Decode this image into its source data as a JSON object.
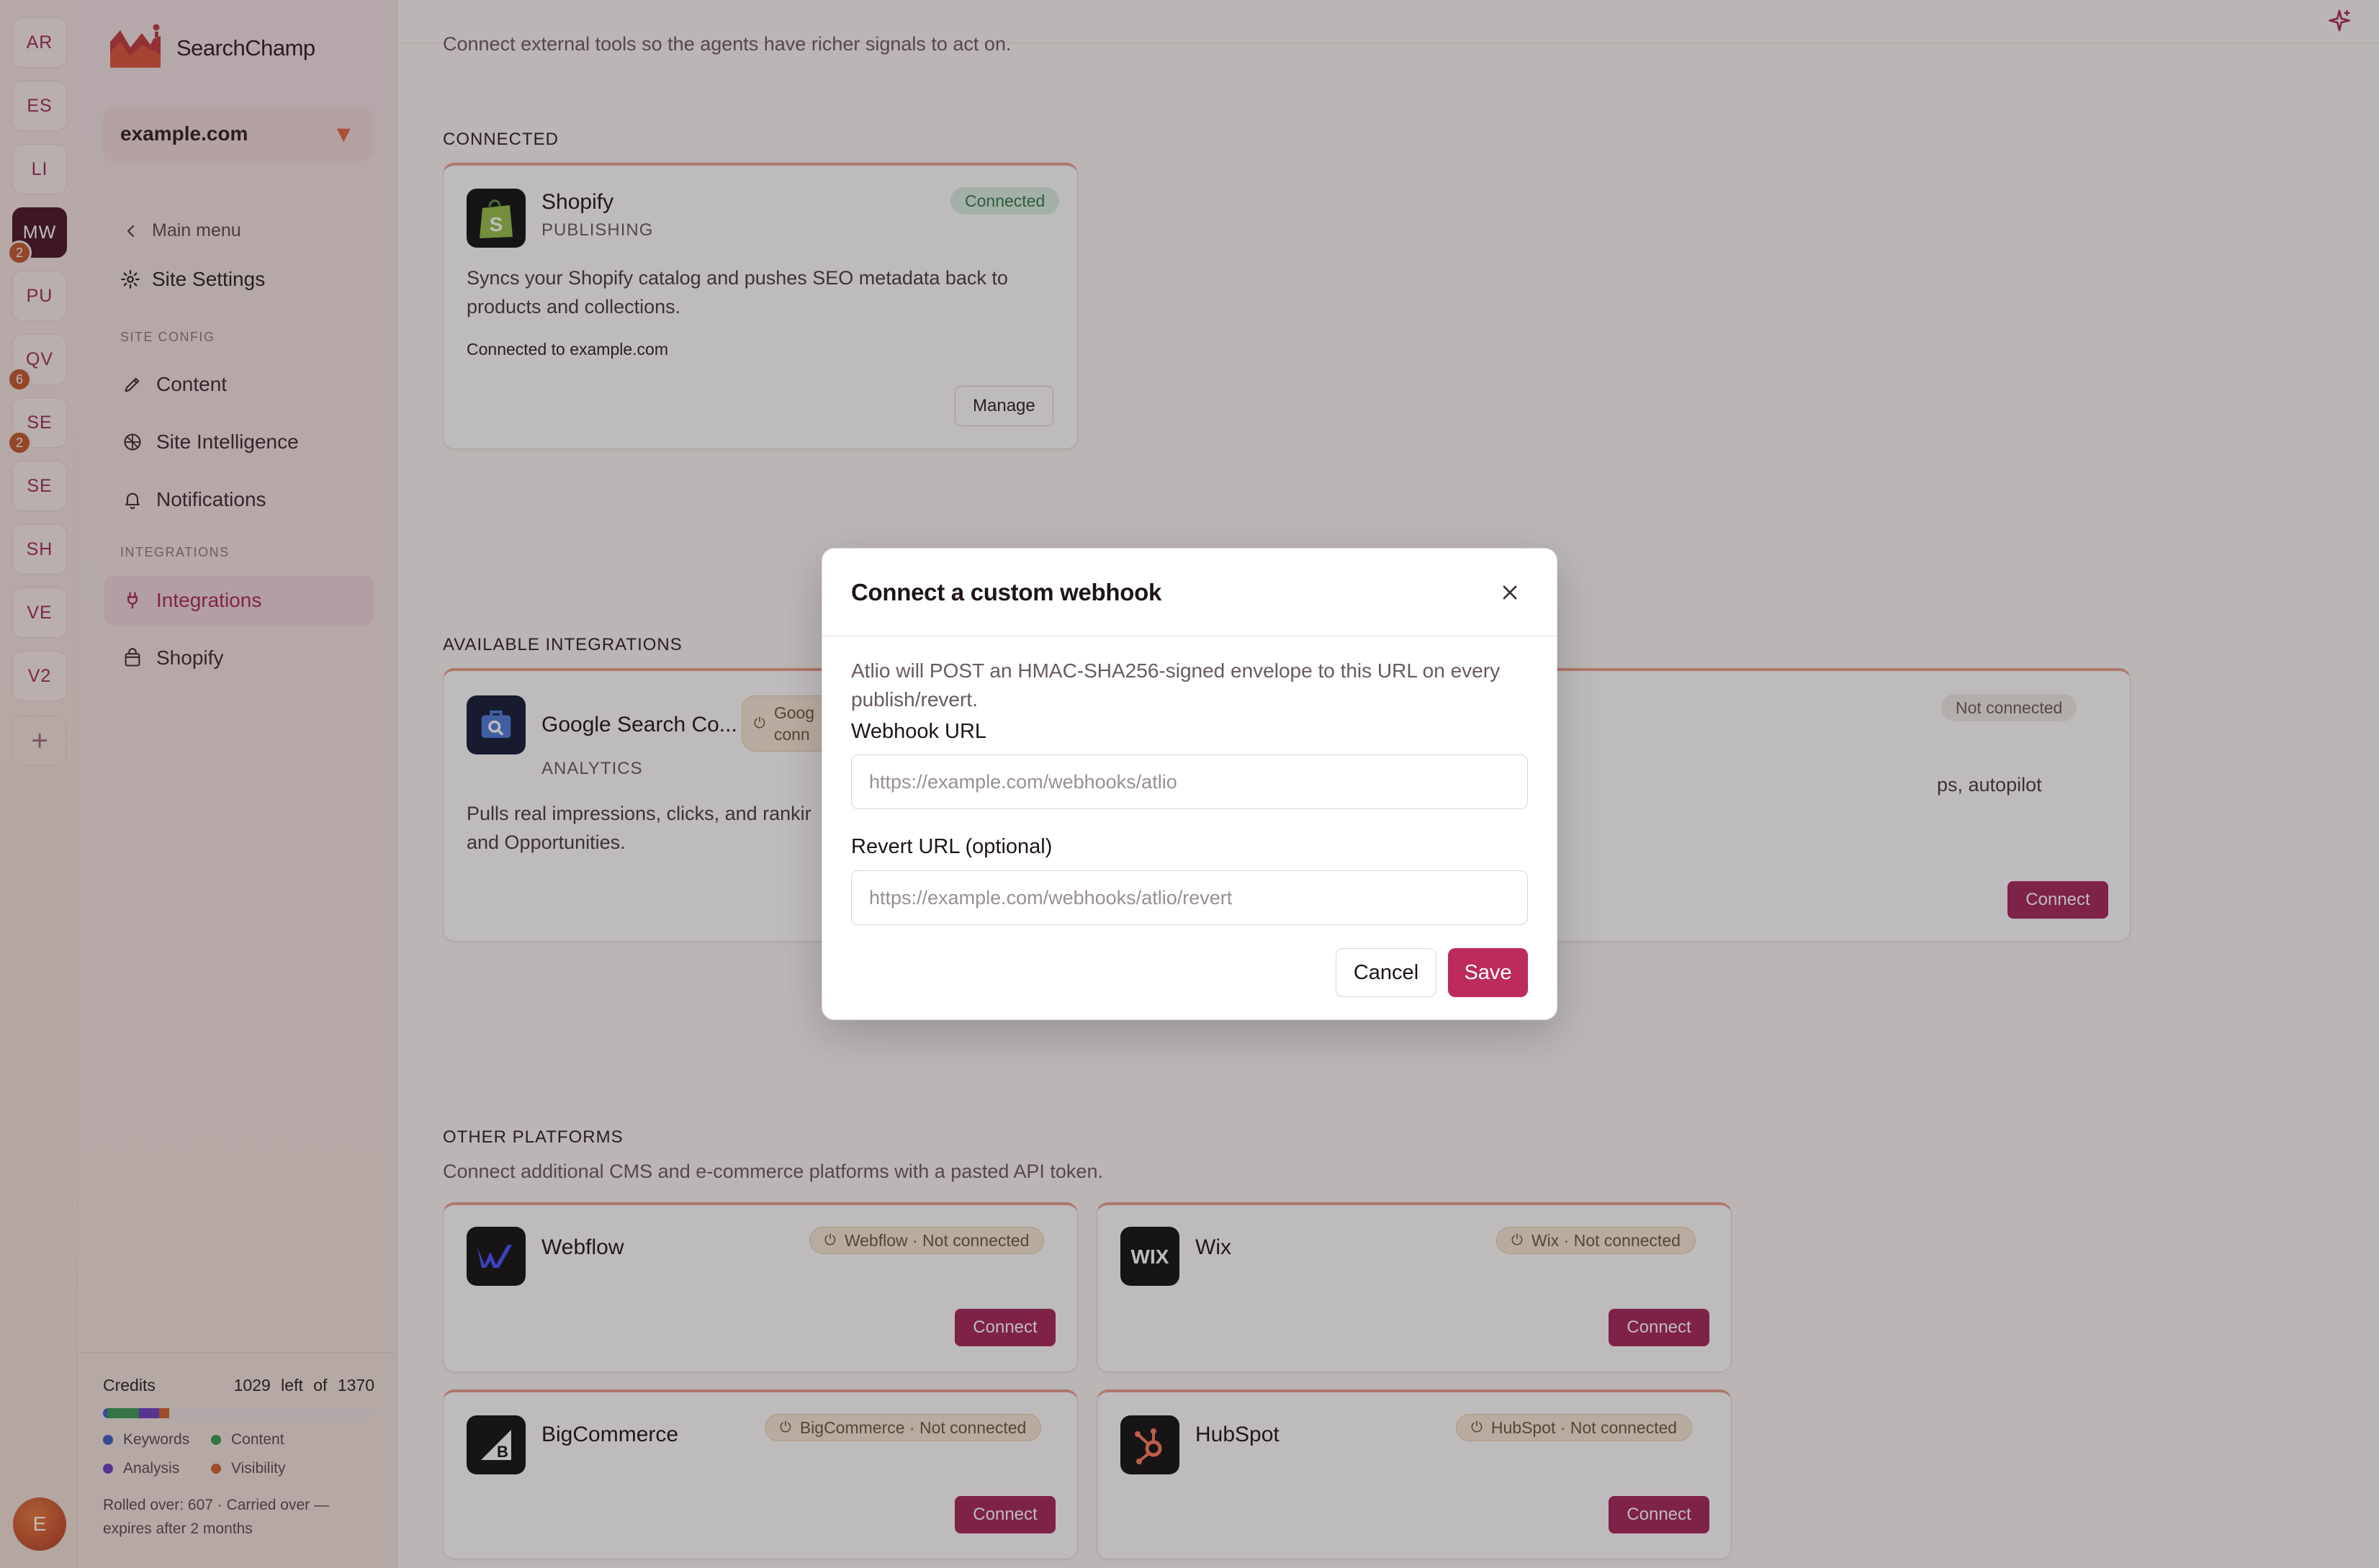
{
  "rail": {
    "items": [
      {
        "label": "AR",
        "badge": ""
      },
      {
        "label": "ES",
        "badge": ""
      },
      {
        "label": "LI",
        "badge": ""
      },
      {
        "label": "MW",
        "badge": "2"
      },
      {
        "label": "PU",
        "badge": ""
      },
      {
        "label": "QV",
        "badge": "6"
      },
      {
        "label": "SE",
        "badge": "2"
      },
      {
        "label": "SE",
        "badge": ""
      },
      {
        "label": "SH",
        "badge": ""
      },
      {
        "label": "VE",
        "badge": ""
      },
      {
        "label": "V2",
        "badge": ""
      }
    ],
    "add": "+",
    "avatar": "E"
  },
  "sidebar": {
    "brand": "SearchChamp",
    "site": "example.com",
    "main_menu": "Main menu",
    "title": "Site Settings",
    "site_config_label": "SITE CONFIG",
    "items": [
      {
        "label": "Content"
      },
      {
        "label": "Site Intelligence"
      },
      {
        "label": "Notifications"
      }
    ],
    "integrations_label": "INTEGRATIONS",
    "integration_items": [
      {
        "label": "Integrations"
      },
      {
        "label": "Shopify"
      }
    ],
    "credits": {
      "label": "Credits",
      "left": "1029",
      "left_word": "left",
      "of_word": "of",
      "total": "1370",
      "legend": [
        "Keywords",
        "Content",
        "Analysis",
        "Visibility"
      ],
      "legend_colors": [
        "#3b5fc9",
        "#3a9a55",
        "#6b3fc0",
        "#d2632a"
      ],
      "rolled": "Rolled over: 607 · Carried over — expires after 2 months"
    }
  },
  "main": {
    "intro": "Connect external tools so the agents have richer signals to act on.",
    "connected_title": "CONNECTED",
    "shopify": {
      "name": "Shopify",
      "category": "PUBLISHING",
      "status": "Connected",
      "desc": "Syncs your Shopify catalog and pushes SEO metadata back to products and collections.",
      "note": "Connected to example.com",
      "manage": "Manage"
    },
    "available_title": "AVAILABLE INTEGRATIONS",
    "gsc": {
      "name": "Google Search Co...",
      "category": "ANALYTICS",
      "status": "Goog conn",
      "desc": "Pulls real impressions, clicks, and rankir and Opportunities."
    },
    "second": {
      "status": "Not connected",
      "desc": "ps, autopilot",
      "connect": "Connect"
    },
    "other_title": "OTHER PLATFORMS",
    "other_desc": "Connect additional CMS and e-commerce platforms with a pasted API token.",
    "platforms": [
      {
        "name": "Webflow",
        "status": "Webflow · Not connected",
        "connect": "Connect"
      },
      {
        "name": "Wix",
        "status": "Wix · Not connected",
        "connect": "Connect"
      },
      {
        "name": "BigCommerce",
        "status": "BigCommerce · Not connected",
        "connect": "Connect"
      },
      {
        "name": "HubSpot",
        "status": "HubSpot · Not connected",
        "connect": "Connect"
      }
    ]
  },
  "modal": {
    "title": "Connect a custom webhook",
    "desc": "Atlio will POST an HMAC-SHA256-signed envelope to this URL on every publish/revert.",
    "webhook_label": "Webhook URL",
    "webhook_placeholder": "https://example.com/webhooks/atlio",
    "webhook_value": "",
    "revert_label": "Revert URL (optional)",
    "revert_placeholder": "https://example.com/webhooks/atlio/revert",
    "revert_value": "",
    "cancel": "Cancel",
    "save": "Save"
  },
  "colors": {
    "accent": "#a52456",
    "save": "#bd2a5e",
    "connected_bg": "#d9efe0",
    "connected_text": "#2f7a4a"
  },
  "icons": {
    "brand": "searchchamp-logo",
    "sparkle": "sparkle-icon",
    "close": "close-icon",
    "back": "chevron-left-icon",
    "settings": "gear-icon",
    "content": "pen-icon",
    "site_intelligence": "brain-icon",
    "notifications": "bell-icon",
    "integrations": "plug-icon",
    "shopify": "shopping-bag-icon"
  }
}
